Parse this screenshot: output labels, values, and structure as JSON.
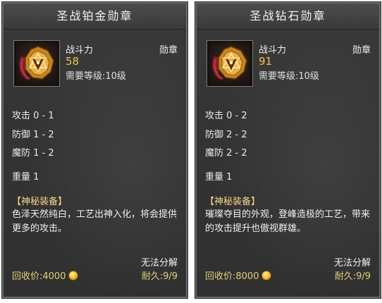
{
  "cards": [
    {
      "title": "圣战铂金勋章",
      "power_label": "战斗力",
      "power_value": "58",
      "level_requirement": "需要等级:10级",
      "item_type": "勋章",
      "icon": "medal-icon",
      "stats": [
        {
          "text": "攻击 0 - 1"
        },
        {
          "text": "防御 1 - 2"
        },
        {
          "text": "魔防 1 - 2"
        }
      ],
      "weight": "重量 1",
      "description_title": "【神秘装备】",
      "description": "色泽天然纯白，工艺出神入化，将会提供更多的攻击。",
      "undismantle": "无法分解",
      "recycle_price": "回收价:4000",
      "durability": "耐久:9/9"
    },
    {
      "title": "圣战钻石勋章",
      "power_label": "战斗力",
      "power_value": "91",
      "level_requirement": "需要等级:10级",
      "item_type": "勋章",
      "icon": "medal-icon",
      "stats": [
        {
          "text": "攻击 0 - 2"
        },
        {
          "text": "防御 2 - 2"
        },
        {
          "text": "魔防 2 - 2"
        }
      ],
      "weight": "重量 1",
      "description_title": "【神秘装备】",
      "description": "璀璨夺目的外观，登峰造极的工艺，带来的攻击提升也傲视群雄。",
      "undismantle": "无法分解",
      "recycle_price": "回收价:8000",
      "durability": "耐久:9/9"
    }
  ],
  "colors": {
    "panel_bg": "#343434",
    "power_value": "#f2c14e",
    "description_title": "#f5d38a",
    "price": "#e7cf7a"
  }
}
